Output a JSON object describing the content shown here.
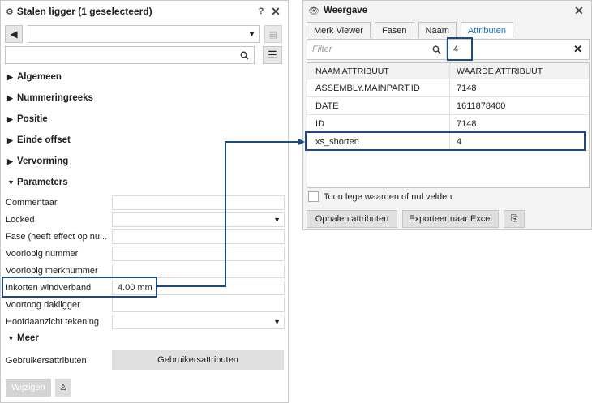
{
  "left": {
    "title": "Stalen ligger (1 geselecteerd)",
    "sections": [
      "Algemeen",
      "Nummeringreeks",
      "Positie",
      "Einde offset",
      "Vervorming"
    ],
    "parameters_title": "Parameters",
    "props": [
      {
        "label": "Commentaar",
        "value": "",
        "dropdown": false
      },
      {
        "label": "Locked",
        "value": "",
        "dropdown": true
      },
      {
        "label": "Fase (heeft effect op nu...",
        "value": "",
        "dropdown": false
      },
      {
        "label": "Voorlopig nummer",
        "value": "",
        "dropdown": false
      },
      {
        "label": "Voorlopig merknummer",
        "value": "",
        "dropdown": false
      },
      {
        "label": "Inkorten windverband",
        "value": "4.00 mm",
        "dropdown": false
      },
      {
        "label": "Voortoog dakligger",
        "value": "",
        "dropdown": false
      },
      {
        "label": "Hoofdaanzicht tekening",
        "value": "",
        "dropdown": true
      }
    ],
    "meer_title": "Meer",
    "gebruikers_label": "Gebruikersattributen",
    "gebruikers_button": "Gebruikersattributen",
    "wijzigen_button": "Wijzigen"
  },
  "right": {
    "title": "Weergave",
    "tabs": [
      "Merk Viewer",
      "Fasen",
      "Naam",
      "Attributen"
    ],
    "active_tab": "Attributen",
    "filter_placeholder": "Filter",
    "filter_value": "4",
    "columns": [
      "NAAM ATTRIBUUT",
      "WAARDE ATTRIBUUT"
    ],
    "rows": [
      {
        "name": "ASSEMBLY.MAINPART.ID",
        "value": "7148"
      },
      {
        "name": "DATE",
        "value": "1611878400"
      },
      {
        "name": "ID",
        "value": "7148"
      },
      {
        "name": "xs_shorten",
        "value": "4"
      }
    ],
    "checkbox_label": "Toon lege waarden of nul velden",
    "btn_ophalen": "Ophalen attributen",
    "btn_exporteer": "Exporteer naar Excel"
  },
  "colors": {
    "highlight": "#1c4a80",
    "active_tab": "#1b73b9"
  }
}
